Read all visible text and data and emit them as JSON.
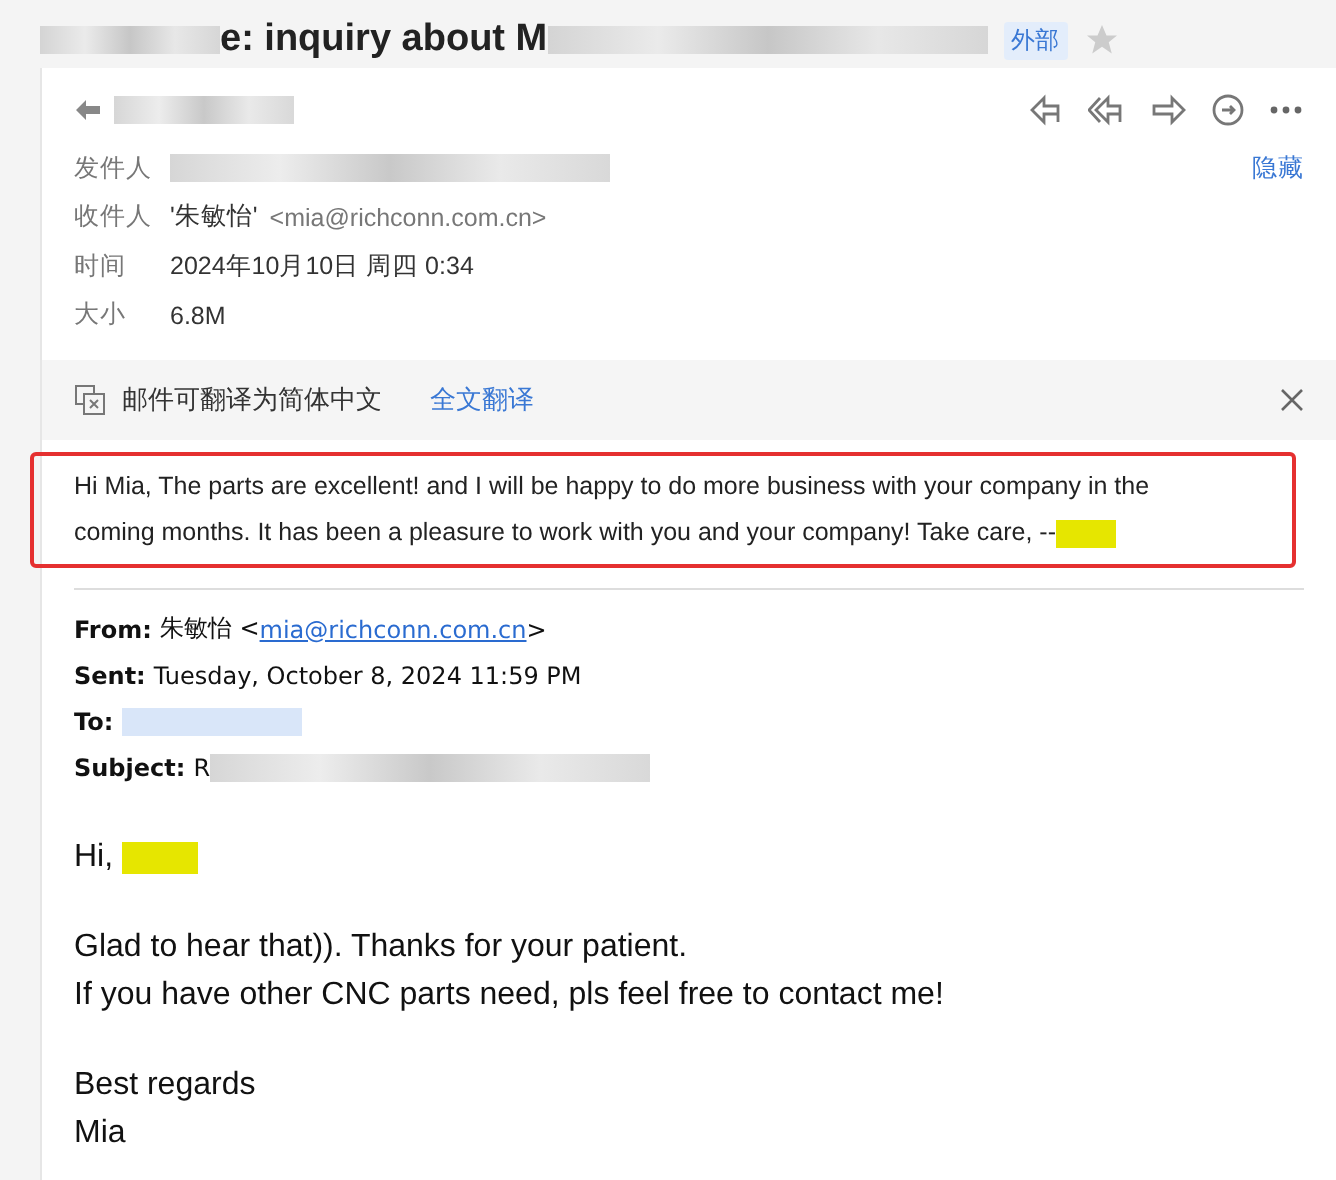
{
  "subject": {
    "segments": [
      {
        "kind": "blur_short"
      },
      {
        "kind": "text",
        "text": "e: inquiry about M"
      },
      {
        "kind": "blur_long"
      }
    ],
    "badge": "外部",
    "starred": false
  },
  "sender_name": {
    "segments": [
      {
        "kind": "blur_short"
      }
    ]
  },
  "meta": [
    {
      "label": "发件人",
      "segments": [
        {
          "kind": "blur_long"
        }
      ]
    },
    {
      "label": "收件人",
      "segments": [
        {
          "kind": "text",
          "text": "'朱敏怡'"
        },
        {
          "kind": "muted",
          "text": "<mia@richconn.com.cn>"
        }
      ]
    },
    {
      "label": "时间",
      "segments": [
        {
          "kind": "text",
          "text": "2024年10月10日 周四 0:34"
        }
      ]
    },
    {
      "label": "大小",
      "segments": [
        {
          "kind": "text",
          "text": "6.8M"
        }
      ]
    }
  ],
  "hide_link": "隐藏",
  "translate": {
    "message": "邮件可翻译为简体中文",
    "action": "全文翻译"
  },
  "reply": {
    "lines": [
      "Hi Mia,  The parts are excellent! and I will be happy to do more business with your company in the",
      "coming months.  It has been a pleasure to work with you and your company!  Take care, --"
    ],
    "signature_highlighted": true
  },
  "quoted": [
    {
      "label": "From:",
      "segments": [
        {
          "kind": "text",
          "text": "朱敏怡 <"
        },
        {
          "kind": "link",
          "text": "mia@richconn.com.cn"
        },
        {
          "kind": "text",
          "text": ">"
        }
      ]
    },
    {
      "label": "Sent:",
      "segments": [
        {
          "kind": "text",
          "text": "Tuesday, October 8, 2024 11:59 PM"
        }
      ]
    },
    {
      "label": "To:",
      "segments": [
        {
          "kind": "blur_link"
        }
      ]
    },
    {
      "label": "Subject:",
      "segments": [
        {
          "kind": "text",
          "text": "R"
        },
        {
          "kind": "blur_long"
        }
      ]
    }
  ],
  "greeting": "Hi,",
  "body": [
    "Glad to hear that)). Thanks for your patient.",
    "If you have other CNC parts need, pls feel free to contact me!"
  ],
  "closing": [
    "Best regards",
    "Mia"
  ]
}
